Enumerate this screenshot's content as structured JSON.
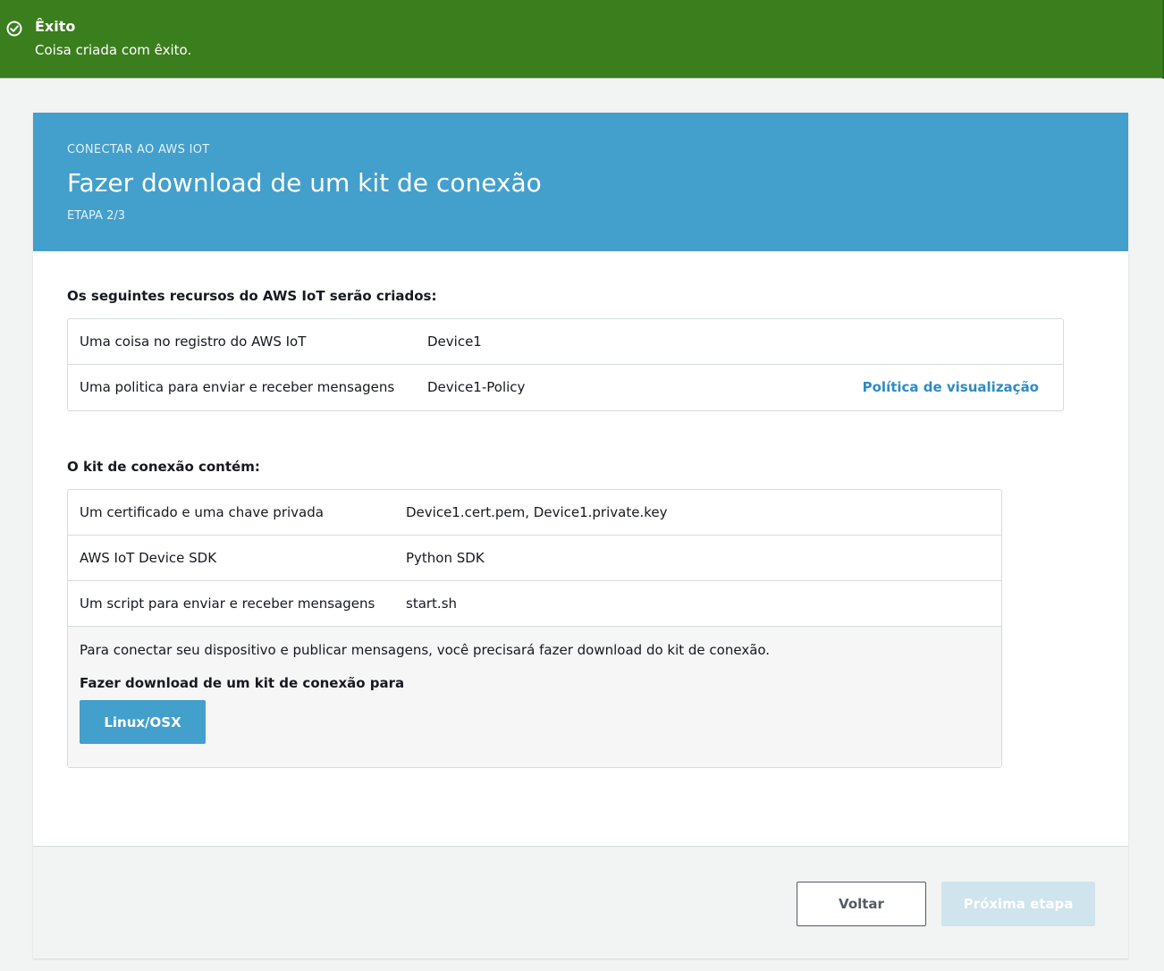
{
  "banner": {
    "icon": "check-circle-icon",
    "title": "Êxito",
    "message": "Coisa criada com êxito.",
    "color": "#3b7e1e"
  },
  "header": {
    "eyebrow": "CONECTAR AO AWS IOT",
    "title": "Fazer download de um kit de conexão",
    "step": "ETAPA 2/3",
    "color": "#439fcb"
  },
  "resources": {
    "label": "Os seguintes recursos do AWS IoT serão criados:",
    "rows": [
      {
        "name": "Uma coisa no registro do AWS IoT",
        "value": "Device1"
      },
      {
        "name": "Uma politica para enviar e receber mensagens",
        "value": "Device1-Policy",
        "link": "Política de visualização"
      }
    ]
  },
  "kit": {
    "label": "O kit de conexão contém:",
    "rows": [
      {
        "name": "Um certificado e uma chave privada",
        "value": "Device1.cert.pem, Device1.private.key"
      },
      {
        "name": "AWS IoT Device SDK",
        "value": "Python SDK"
      },
      {
        "name": "Um script para enviar e receber mensagens",
        "value": "start.sh"
      }
    ],
    "download_info": "Para conectar seu dispositivo e publicar mensagens, você precisará fazer download do kit de conexão.",
    "download_label": "Fazer download de um kit de conexão para",
    "download_button": "Linux/OSX"
  },
  "footer": {
    "back_label": "Voltar",
    "next_label": "Próxima etapa"
  }
}
